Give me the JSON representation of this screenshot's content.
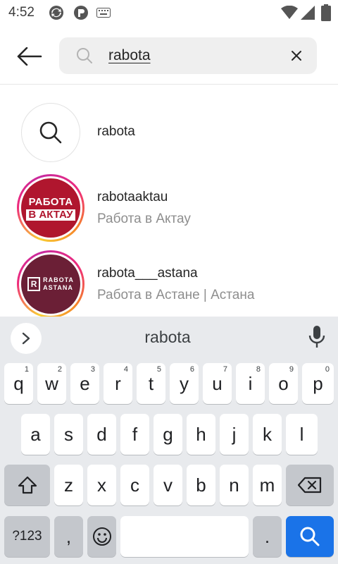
{
  "status_bar": {
    "time": "4:52",
    "icons": [
      "sync-icon",
      "app-icon",
      "keyboard-icon",
      "wifi-icon",
      "signal-icon",
      "battery-icon"
    ]
  },
  "header": {
    "back_icon": "arrow-left-icon",
    "search": {
      "value": "rabota",
      "search_icon": "search-icon",
      "clear_icon": "close-icon"
    }
  },
  "results": [
    {
      "type": "query",
      "title": "rabota",
      "icon": "search-icon"
    },
    {
      "type": "account",
      "title": "rabotaaktau",
      "subtitle": "Работа в Актау",
      "avatar_line1": "РАБОТА",
      "avatar_line2": "В АКТАУ"
    },
    {
      "type": "account",
      "title": "rabota___astana",
      "subtitle": "Работа в Астане | Астана",
      "avatar_mark": "R",
      "avatar_line1": "RABOTA",
      "avatar_line2": "ASTANA"
    }
  ],
  "keyboard": {
    "suggestion": "rabota",
    "row1": [
      {
        "label": "q",
        "hint": "1"
      },
      {
        "label": "w",
        "hint": "2"
      },
      {
        "label": "e",
        "hint": "3"
      },
      {
        "label": "r",
        "hint": "4"
      },
      {
        "label": "t",
        "hint": "5"
      },
      {
        "label": "y",
        "hint": "6"
      },
      {
        "label": "u",
        "hint": "7"
      },
      {
        "label": "i",
        "hint": "8"
      },
      {
        "label": "o",
        "hint": "9"
      },
      {
        "label": "p",
        "hint": "0"
      }
    ],
    "row2": [
      "a",
      "s",
      "d",
      "f",
      "g",
      "h",
      "j",
      "k",
      "l"
    ],
    "row3": [
      "z",
      "x",
      "c",
      "v",
      "b",
      "n",
      "m"
    ],
    "symbols_label": "?123",
    "comma": ",",
    "period": ".",
    "colors": {
      "background": "#e8eaed",
      "key": "#ffffff",
      "function_key": "#c4c7cc",
      "enter": "#1a73e8"
    }
  },
  "colors": {
    "ring_gradient": [
      "#f9ce34",
      "#ee2a7b",
      "#f58529"
    ],
    "aktau_brand": "#b0162e",
    "astana_brand": "#6b1f36"
  }
}
